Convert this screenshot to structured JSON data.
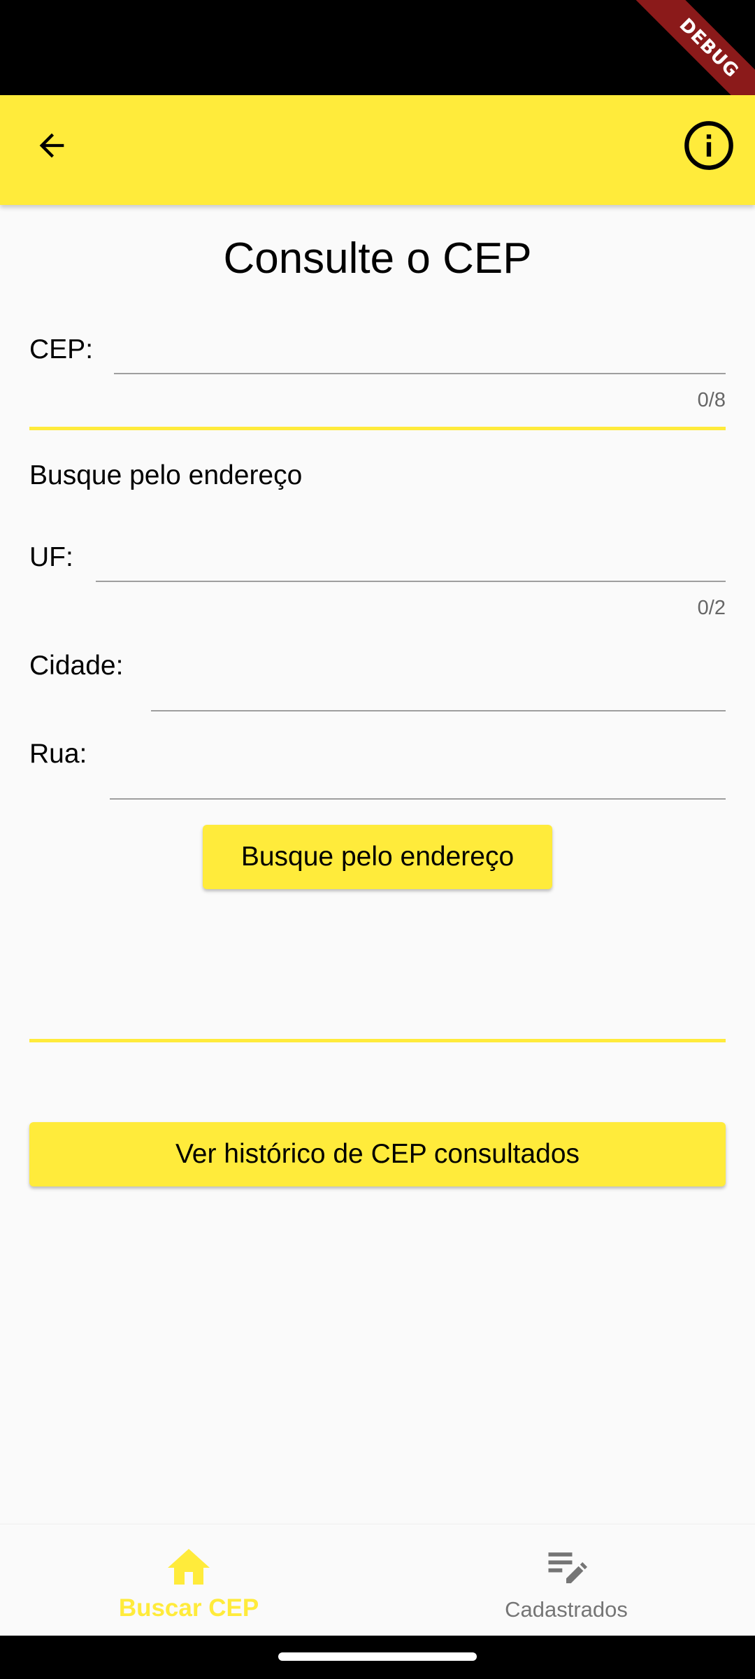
{
  "status_bar": {
    "debug_banner": "DEBUG"
  },
  "app_bar": {
    "back_icon": "arrow-back-icon",
    "info_icon": "info-outline-icon"
  },
  "main": {
    "title": "Consulte o CEP",
    "cep": {
      "label": "CEP:",
      "value": "",
      "counter": "0/8"
    },
    "address_section_title": "Busque pelo endereço",
    "uf": {
      "label": "UF:",
      "value": "",
      "counter": "0/2"
    },
    "cidade": {
      "label": "Cidade:",
      "value": ""
    },
    "rua": {
      "label": "Rua:",
      "value": ""
    },
    "search_button": "Busque pelo endereço",
    "history_button": "Ver histórico de CEP consultados"
  },
  "bottom_nav": {
    "items": [
      {
        "label": "Buscar CEP",
        "icon": "home-icon",
        "active": true
      },
      {
        "label": "Cadastrados",
        "icon": "edit-note-icon",
        "active": false
      }
    ]
  },
  "colors": {
    "accent": "#ffeb3b",
    "inactive": "#757575",
    "background": "#fafafa"
  }
}
